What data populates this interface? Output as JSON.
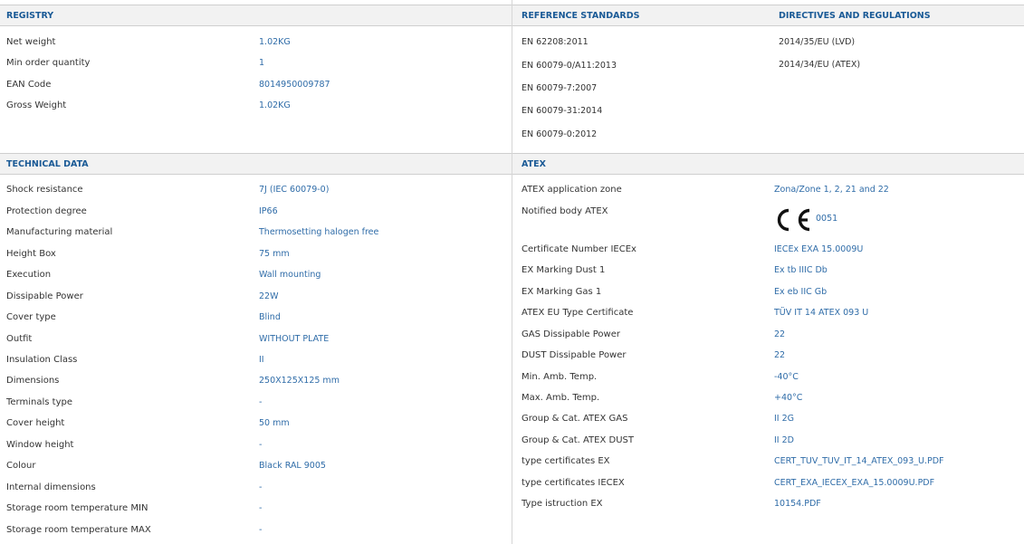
{
  "registry": {
    "title": "REGISTRY",
    "rows": [
      {
        "label": "Net weight",
        "value": "1.02KG"
      },
      {
        "label": "Min order quantity",
        "value": "1"
      },
      {
        "label": "EAN Code",
        "value": "8014950009787"
      },
      {
        "label": "Gross Weight",
        "value": "1.02KG"
      }
    ]
  },
  "reference_standards": {
    "title": "REFERENCE STANDARDS",
    "items": [
      "EN 62208:2011",
      "EN 60079-0/A11:2013",
      "EN 60079-7:2007",
      "EN 60079-31:2014",
      "EN 60079-0:2012"
    ]
  },
  "directives": {
    "title": "DIRECTIVES AND REGULATIONS",
    "items": [
      "2014/35/EU (LVD)",
      "2014/34/EU (ATEX)"
    ]
  },
  "technical": {
    "title": "TECHNICAL DATA",
    "rows": [
      {
        "label": "Shock resistance",
        "value": "7J (IEC 60079-0)"
      },
      {
        "label": "Protection degree",
        "value": "IP66"
      },
      {
        "label": "Manufacturing material",
        "value": "Thermosetting halogen free"
      },
      {
        "label": "Height Box",
        "value": "75 mm"
      },
      {
        "label": "Execution",
        "value": "Wall mounting"
      },
      {
        "label": "Dissipable Power",
        "value": "22W"
      },
      {
        "label": "Cover type",
        "value": "Blind"
      },
      {
        "label": "Outfit",
        "value": "WITHOUT PLATE"
      },
      {
        "label": "Insulation Class",
        "value": "II"
      },
      {
        "label": "Dimensions",
        "value": "250X125X125 mm"
      },
      {
        "label": "Terminals type",
        "value": "-"
      },
      {
        "label": "Cover height",
        "value": "50 mm"
      },
      {
        "label": "Window height",
        "value": "-"
      },
      {
        "label": "Colour",
        "value": "Black RAL 9005"
      },
      {
        "label": "Internal dimensions",
        "value": "-"
      },
      {
        "label": "Storage room temperature MIN",
        "value": "-"
      },
      {
        "label": "Storage room temperature MAX",
        "value": "-"
      }
    ]
  },
  "atex": {
    "title": "ATEX",
    "application_zone": {
      "label": "ATEX application zone",
      "value": "Zona/Zone 1, 2, 21 and 22"
    },
    "notified_body": {
      "label": "Notified body ATEX",
      "mark": "CE",
      "number": "0051"
    },
    "rows": [
      {
        "label": "Certificate Number IECEx",
        "value": "IECEx EXA 15.0009U"
      },
      {
        "label": "EX Marking Dust 1",
        "value": "Ex tb IIIC Db"
      },
      {
        "label": "EX Marking Gas 1",
        "value": "Ex eb IIC Gb"
      },
      {
        "label": "ATEX EU Type Certificate",
        "value": "TÜV IT 14 ATEX 093 U"
      },
      {
        "label": "GAS Dissipable Power",
        "value": "22"
      },
      {
        "label": "DUST Dissipable Power",
        "value": "22"
      },
      {
        "label": "Min. Amb. Temp.",
        "value": "-40°C"
      },
      {
        "label": "Max. Amb. Temp.",
        "value": "+40°C"
      },
      {
        "label": "Group & Cat. ATEX GAS",
        "value": "II 2G"
      },
      {
        "label": "Group & Cat. ATEX DUST",
        "value": "II 2D"
      },
      {
        "label": "type certificates EX",
        "value": "CERT_TUV_TUV_IT_14_ATEX_093_U.PDF"
      },
      {
        "label": "type certificates IECEX",
        "value": "CERT_EXA_IECEX_EXA_15.0009U.PDF"
      },
      {
        "label": "Type istruction EX",
        "value": "10154.PDF"
      }
    ]
  }
}
